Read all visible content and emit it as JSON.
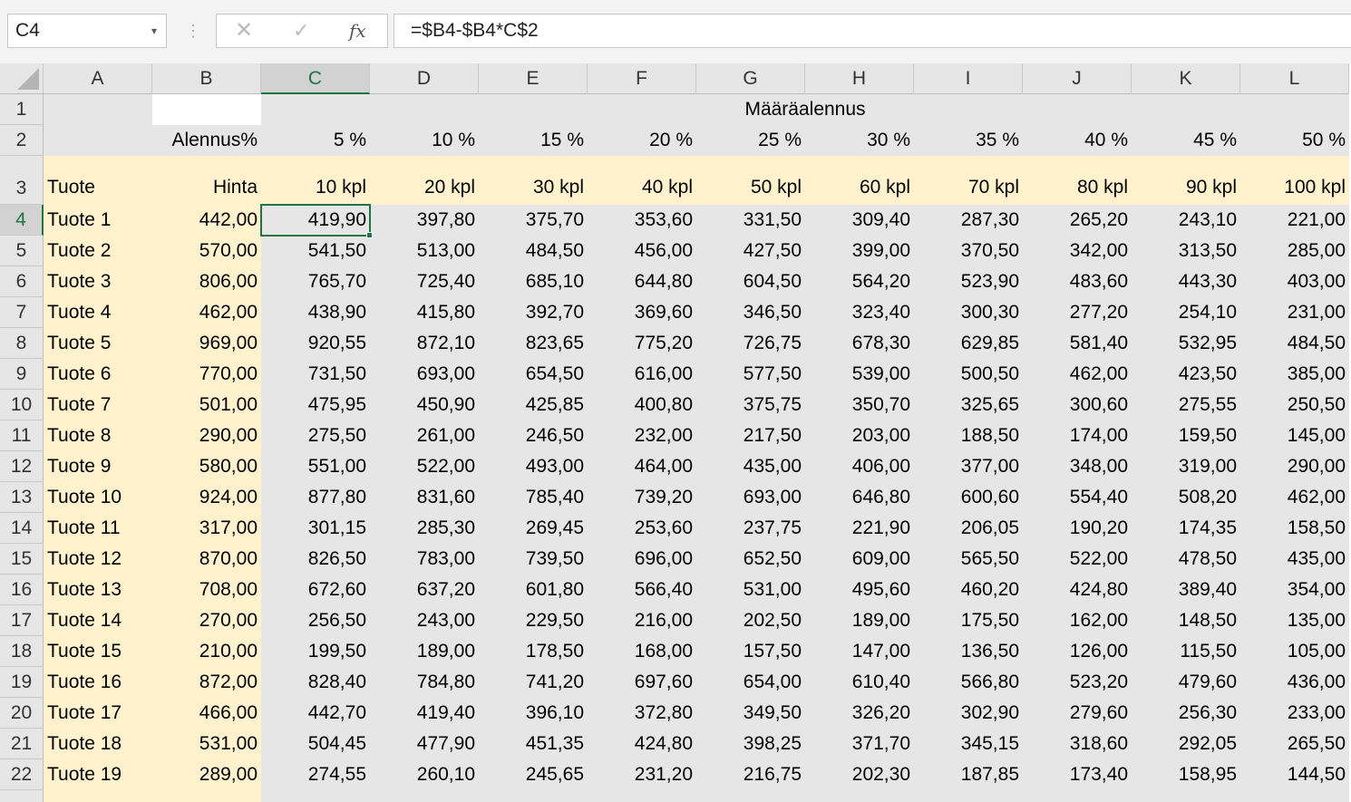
{
  "name_box": "C4",
  "name_box_caret": "▾",
  "formula_dots": "⋮",
  "formula_buttons": {
    "cancel": "✕",
    "enter": "✓",
    "function": "fx"
  },
  "formula": "=$B4-$B4*C$2",
  "columns": [
    "A",
    "B",
    "C",
    "D",
    "E",
    "F",
    "G",
    "H",
    "I",
    "J",
    "K",
    "L"
  ],
  "selected_column": "C",
  "selected_row": 4,
  "row1": {
    "title": "Määräalennus"
  },
  "row2": {
    "label": "Alennus%",
    "discounts": [
      "5 %",
      "10 %",
      "15 %",
      "20 %",
      "25 %",
      "30 %",
      "35 %",
      "40 %",
      "45 %",
      "50 %"
    ]
  },
  "row3": {
    "tuote": "Tuote",
    "hinta": "Hinta",
    "quantities": [
      "10 kpl",
      "20 kpl",
      "30 kpl",
      "40 kpl",
      "50 kpl",
      "60 kpl",
      "70 kpl",
      "80 kpl",
      "90 kpl",
      "100 kpl"
    ]
  },
  "rows": [
    {
      "num": "4",
      "name": "Tuote 1",
      "price": "442,00",
      "vals": [
        "419,90",
        "397,80",
        "375,70",
        "353,60",
        "331,50",
        "309,40",
        "287,30",
        "265,20",
        "243,10",
        "221,00"
      ]
    },
    {
      "num": "5",
      "name": "Tuote 2",
      "price": "570,00",
      "vals": [
        "541,50",
        "513,00",
        "484,50",
        "456,00",
        "427,50",
        "399,00",
        "370,50",
        "342,00",
        "313,50",
        "285,00"
      ]
    },
    {
      "num": "6",
      "name": "Tuote 3",
      "price": "806,00",
      "vals": [
        "765,70",
        "725,40",
        "685,10",
        "644,80",
        "604,50",
        "564,20",
        "523,90",
        "483,60",
        "443,30",
        "403,00"
      ]
    },
    {
      "num": "7",
      "name": "Tuote 4",
      "price": "462,00",
      "vals": [
        "438,90",
        "415,80",
        "392,70",
        "369,60",
        "346,50",
        "323,40",
        "300,30",
        "277,20",
        "254,10",
        "231,00"
      ]
    },
    {
      "num": "8",
      "name": "Tuote 5",
      "price": "969,00",
      "vals": [
        "920,55",
        "872,10",
        "823,65",
        "775,20",
        "726,75",
        "678,30",
        "629,85",
        "581,40",
        "532,95",
        "484,50"
      ]
    },
    {
      "num": "9",
      "name": "Tuote 6",
      "price": "770,00",
      "vals": [
        "731,50",
        "693,00",
        "654,50",
        "616,00",
        "577,50",
        "539,00",
        "500,50",
        "462,00",
        "423,50",
        "385,00"
      ]
    },
    {
      "num": "10",
      "name": "Tuote 7",
      "price": "501,00",
      "vals": [
        "475,95",
        "450,90",
        "425,85",
        "400,80",
        "375,75",
        "350,70",
        "325,65",
        "300,60",
        "275,55",
        "250,50"
      ]
    },
    {
      "num": "11",
      "name": "Tuote 8",
      "price": "290,00",
      "vals": [
        "275,50",
        "261,00",
        "246,50",
        "232,00",
        "217,50",
        "203,00",
        "188,50",
        "174,00",
        "159,50",
        "145,00"
      ]
    },
    {
      "num": "12",
      "name": "Tuote 9",
      "price": "580,00",
      "vals": [
        "551,00",
        "522,00",
        "493,00",
        "464,00",
        "435,00",
        "406,00",
        "377,00",
        "348,00",
        "319,00",
        "290,00"
      ]
    },
    {
      "num": "13",
      "name": "Tuote 10",
      "price": "924,00",
      "vals": [
        "877,80",
        "831,60",
        "785,40",
        "739,20",
        "693,00",
        "646,80",
        "600,60",
        "554,40",
        "508,20",
        "462,00"
      ]
    },
    {
      "num": "14",
      "name": "Tuote 11",
      "price": "317,00",
      "vals": [
        "301,15",
        "285,30",
        "269,45",
        "253,60",
        "237,75",
        "221,90",
        "206,05",
        "190,20",
        "174,35",
        "158,50"
      ]
    },
    {
      "num": "15",
      "name": "Tuote 12",
      "price": "870,00",
      "vals": [
        "826,50",
        "783,00",
        "739,50",
        "696,00",
        "652,50",
        "609,00",
        "565,50",
        "522,00",
        "478,50",
        "435,00"
      ]
    },
    {
      "num": "16",
      "name": "Tuote 13",
      "price": "708,00",
      "vals": [
        "672,60",
        "637,20",
        "601,80",
        "566,40",
        "531,00",
        "495,60",
        "460,20",
        "424,80",
        "389,40",
        "354,00"
      ]
    },
    {
      "num": "17",
      "name": "Tuote 14",
      "price": "270,00",
      "vals": [
        "256,50",
        "243,00",
        "229,50",
        "216,00",
        "202,50",
        "189,00",
        "175,50",
        "162,00",
        "148,50",
        "135,00"
      ]
    },
    {
      "num": "18",
      "name": "Tuote 15",
      "price": "210,00",
      "vals": [
        "199,50",
        "189,00",
        "178,50",
        "168,00",
        "157,50",
        "147,00",
        "136,50",
        "126,00",
        "115,50",
        "105,00"
      ]
    },
    {
      "num": "19",
      "name": "Tuote 16",
      "price": "872,00",
      "vals": [
        "828,40",
        "784,80",
        "741,20",
        "697,60",
        "654,00",
        "610,40",
        "566,80",
        "523,20",
        "479,60",
        "436,00"
      ]
    },
    {
      "num": "20",
      "name": "Tuote 17",
      "price": "466,00",
      "vals": [
        "442,70",
        "419,40",
        "396,10",
        "372,80",
        "349,50",
        "326,20",
        "302,90",
        "279,60",
        "256,30",
        "233,00"
      ]
    },
    {
      "num": "21",
      "name": "Tuote 18",
      "price": "531,00",
      "vals": [
        "504,45",
        "477,90",
        "451,35",
        "424,80",
        "398,25",
        "371,70",
        "345,15",
        "318,60",
        "292,05",
        "265,50"
      ]
    },
    {
      "num": "22",
      "name": "Tuote 19",
      "price": "289,00",
      "vals": [
        "274,55",
        "260,10",
        "245,65",
        "231,20",
        "216,75",
        "202,30",
        "187,85",
        "173,40",
        "158,95",
        "144,50"
      ]
    }
  ],
  "colors": {
    "header_bg": "#e6e6e6",
    "gray_fill": "#e7e6e6",
    "cream_fill": "#fff2cc",
    "accent": "#217346"
  }
}
